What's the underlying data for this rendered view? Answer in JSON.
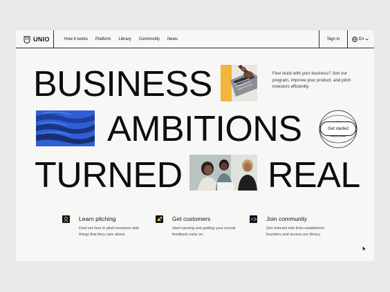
{
  "nav": {
    "logo_text": "UNIO",
    "links": [
      "How it works",
      "Platform",
      "Library",
      "Community",
      "News"
    ],
    "signin_label": "Sign in",
    "lang_label": "En"
  },
  "hero": {
    "words": [
      "BUSINESS",
      "AMBITIONS",
      "TURNED",
      "REAL"
    ],
    "description": "Feel stuck with your business? Join our program, improve your product, and pitch investors efficiently.",
    "cta_label": "Get started"
  },
  "features": [
    {
      "title": "Learn pitching",
      "description": "Find out how to pitch investors with things that they care about."
    },
    {
      "title": "Get customers",
      "description": "Start earning and getting your crucial feedback early on."
    },
    {
      "title": "Join community",
      "description": "Get relevant info from established founders and access our library."
    }
  ],
  "colors": {
    "accent_yellow": "#f3b53a",
    "accent_blue": "#2f5fd6",
    "background": "#f7f7f5",
    "text": "#111111"
  }
}
